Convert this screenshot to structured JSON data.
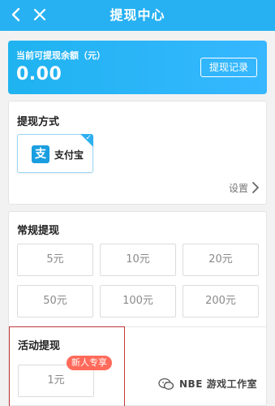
{
  "header": {
    "title": "提现中心",
    "icons": {
      "back": "chevron-left-icon",
      "close": "close-icon"
    }
  },
  "balance": {
    "label": "当前可提现余额（元）",
    "amount": "0.00",
    "record_button": "提现记录"
  },
  "method": {
    "title": "提现方式",
    "option": {
      "icon": "alipay-icon",
      "logo_text": "支",
      "name": "支付宝",
      "selected": true
    },
    "settings_label": "设置"
  },
  "regular": {
    "title": "常规提现",
    "amounts": [
      "5元",
      "10元",
      "20元",
      "50元",
      "100元",
      "200元"
    ]
  },
  "activity": {
    "title": "活动提现",
    "amount": "1元",
    "badge": "新人专享"
  },
  "watermark": {
    "text": "NBE 游戏工作室",
    "icon": "wechat-icon"
  },
  "colors": {
    "primary": "#27b1f2",
    "badge": "#ff6a5a",
    "highlight_border": "#c0393b"
  }
}
